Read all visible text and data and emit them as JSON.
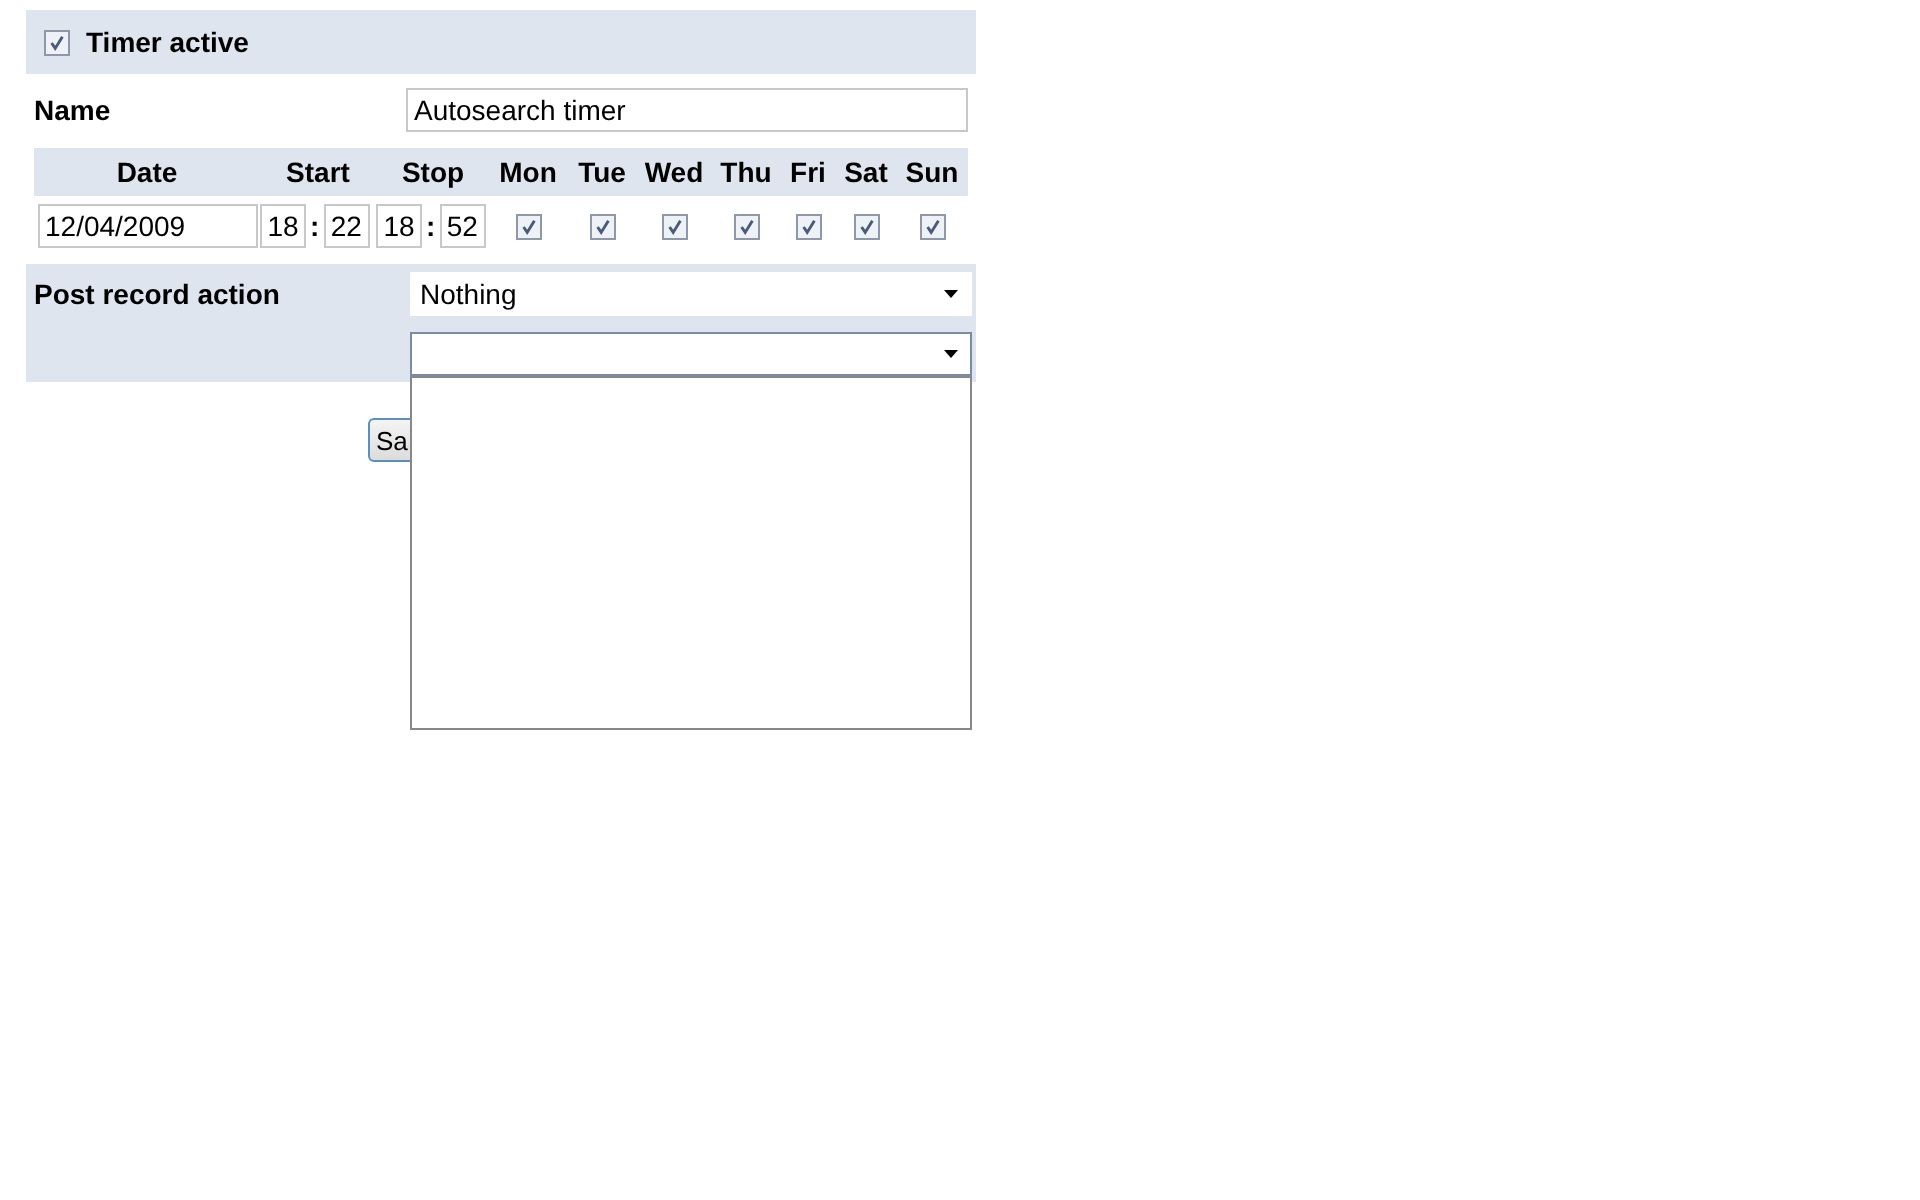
{
  "timer_active": {
    "label": "Timer active",
    "checked": true
  },
  "name": {
    "label": "Name",
    "value": "Autosearch timer"
  },
  "schedule": {
    "columns": [
      "Date",
      "Start",
      "Stop",
      "Mon",
      "Tue",
      "Wed",
      "Thu",
      "Fri",
      "Sat",
      "Sun"
    ],
    "date": "12/04/2009",
    "start_hour": "18",
    "start_minute": "22",
    "stop_hour": "18",
    "stop_minute": "52",
    "separator": ":",
    "days": [
      {
        "checked": true
      },
      {
        "checked": true
      },
      {
        "checked": true
      },
      {
        "checked": true
      },
      {
        "checked": true
      },
      {
        "checked": true
      },
      {
        "checked": true
      }
    ]
  },
  "post_record": {
    "label": "Post record action",
    "action_select": {
      "value": "Nothing"
    },
    "second_select": {
      "expanded": true
    }
  },
  "save_button": {
    "label": "Sa"
  }
}
